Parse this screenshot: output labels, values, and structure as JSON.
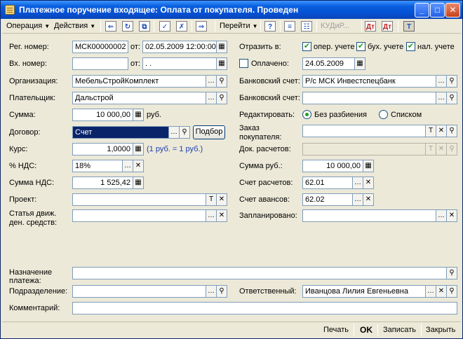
{
  "window": {
    "title": "Платежное поручение входящее: Оплата от покупателя. Проведен"
  },
  "toolbar": {
    "operation": "Операция",
    "actions": "Действия",
    "goto": "Перейти",
    "help": "?",
    "kudir": "КУДиР..."
  },
  "form": {
    "reg_number_label": "Рег. номер:",
    "reg_number": "МСК00000002",
    "from_label": "от:",
    "reg_date": "02.05.2009 12:00:00",
    "in_number_label": "Вх. номер:",
    "in_number": "",
    "in_from_label": "от:",
    "in_date": "  .  .",
    "org_label": "Организация:",
    "org": "МебельСтройКомплект",
    "payer_label": "Плательщик:",
    "payer": "Дальстрой",
    "sum_label": "Сумма:",
    "sum": "10 000,00",
    "sum_unit": "руб.",
    "contract_label": "Договор:",
    "contract": "Счет",
    "podbor": "Подбор",
    "rate_label": "Курс:",
    "rate": "1,0000",
    "rate_hint": "(1 руб. = 1 руб.)",
    "vat_label": "% НДС:",
    "vat": "18%",
    "vat_sum_label": "Сумма НДС:",
    "vat_sum": "1 525,42",
    "project_label": "Проект:",
    "project": "",
    "cashflow_label_1": "Статья движ.",
    "cashflow_label_2": "ден. средств:",
    "cashflow": "",
    "reflect_label": "Отразить в:",
    "reflect_oper": "опер. учете",
    "reflect_buh": "бух. учете",
    "reflect_nal": "нал. учете",
    "paid_label": "Оплачено:",
    "paid_date": "24.05.2009",
    "bank_acc_label": "Банковский счет:",
    "bank_acc": "Р/с МСК Инвестспецбанк",
    "bank_acc2_label": "Банковский счет:",
    "bank_acc2": "",
    "edit_label": "Редактировать:",
    "edit_opt1": "Без разбиения",
    "edit_opt2": "Списком",
    "order_label_1": "Заказ",
    "order_label_2": "покупателя:",
    "order": "",
    "settle_doc_label": "Док. расчетов:",
    "settle_doc": "",
    "sum_rub_label": "Сумма руб.:",
    "sum_rub": "10 000,00",
    "settle_acc_label": "Счет расчетов:",
    "settle_acc": "62.01",
    "adv_acc_label": "Счет авансов:",
    "adv_acc": "62.02",
    "planned_label": "Запланировано:",
    "planned": "",
    "purpose_label_1": "Назначение",
    "purpose_label_2": "платежа:",
    "purpose": "",
    "division_label": "Подразделение:",
    "division": "",
    "responsible_label": "Ответственный:",
    "responsible": "Иванцова Лилия Евгеньевна",
    "comment_label": "Комментарий:",
    "comment": ""
  },
  "footer": {
    "print": "Печать",
    "ok": "OK",
    "save": "Записать",
    "close": "Закрыть"
  }
}
